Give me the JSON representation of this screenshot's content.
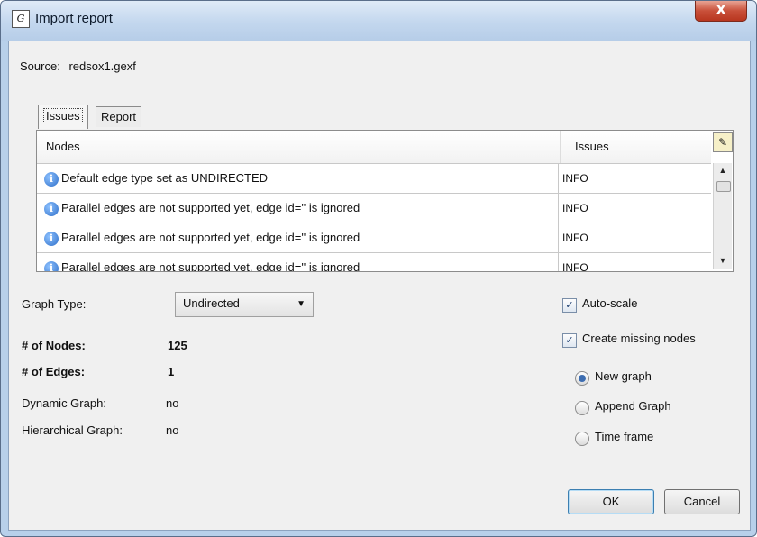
{
  "window": {
    "title": "Import report",
    "close_label": "X",
    "app_icon": "G"
  },
  "source": {
    "label": "Source:",
    "file": "redsox1.gexf"
  },
  "tabs": [
    {
      "label": "Issues",
      "selected": true
    },
    {
      "label": "Report",
      "selected": false
    }
  ],
  "issues_table": {
    "columns": [
      "Nodes",
      "Issues"
    ],
    "corner_icon": "column-chooser-icon",
    "rows": [
      {
        "message": "Default edge type set as UNDIRECTED",
        "issue": "INFO",
        "icon": "info-icon"
      },
      {
        "message": "Parallel edges are not supported yet, edge id='' is ignored",
        "issue": "INFO",
        "icon": "info-icon"
      },
      {
        "message": "Parallel edges are not supported yet, edge id='' is ignored",
        "issue": "INFO",
        "icon": "info-icon"
      },
      {
        "message": "Parallel edges are not supported yet, edge id='' is ignored",
        "issue": "INFO",
        "icon": "info-icon"
      }
    ]
  },
  "graph_type": {
    "label": "Graph Type:",
    "value": "Undirected"
  },
  "stats": {
    "nodes_label": "# of Nodes:",
    "nodes_value": "125",
    "edges_label": "# of Edges:",
    "edges_value": "1",
    "dynamic_label": "Dynamic Graph:",
    "dynamic_value": "no",
    "hierarchical_label": "Hierarchical Graph:",
    "hierarchical_value": "no"
  },
  "options": {
    "auto_scale": {
      "label": "Auto-scale",
      "checked": true
    },
    "create_missing": {
      "label": "Create missing nodes",
      "checked": true
    },
    "radios": [
      {
        "label": "New graph",
        "selected": true
      },
      {
        "label": "Append Graph",
        "selected": false
      },
      {
        "label": "Time frame",
        "selected": false
      }
    ]
  },
  "buttons": {
    "ok": "OK",
    "cancel": "Cancel"
  }
}
